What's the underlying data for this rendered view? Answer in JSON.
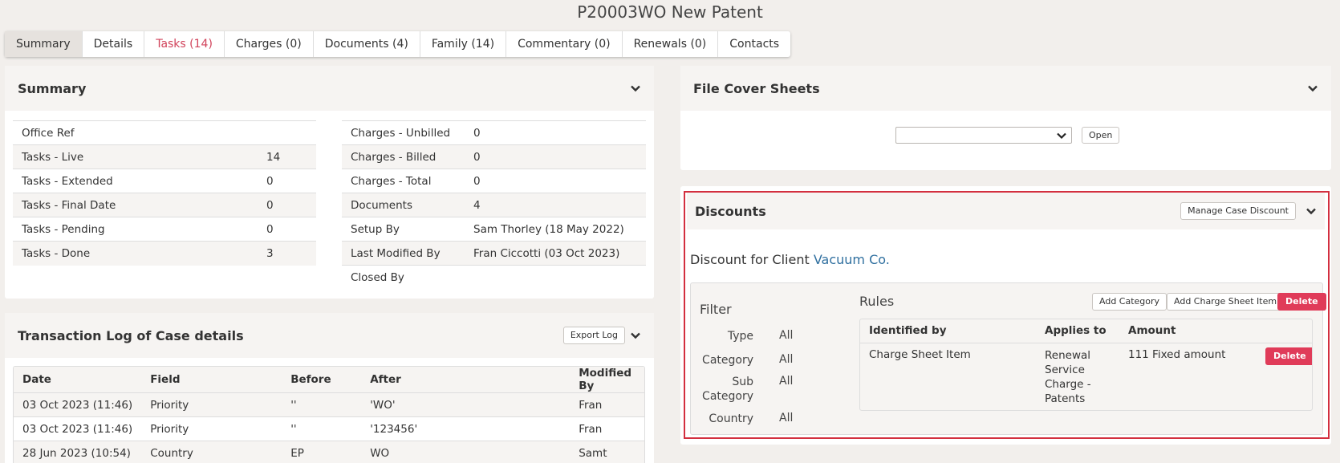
{
  "page": {
    "title": "P20003WO New Patent"
  },
  "tabs": [
    {
      "label": "Summary",
      "active": true
    },
    {
      "label": "Details"
    },
    {
      "label": "Tasks (14)",
      "alert": true
    },
    {
      "label": "Charges (0)"
    },
    {
      "label": "Documents (4)"
    },
    {
      "label": "Family (14)"
    },
    {
      "label": "Commentary (0)"
    },
    {
      "label": "Renewals (0)"
    },
    {
      "label": "Contacts"
    }
  ],
  "summary": {
    "title": "Summary",
    "left": [
      {
        "label": "Office Ref",
        "value": ""
      },
      {
        "label": "Tasks - Live",
        "value": "14"
      },
      {
        "label": "Tasks - Extended",
        "value": "0"
      },
      {
        "label": "Tasks - Final Date",
        "value": "0"
      },
      {
        "label": "Tasks - Pending",
        "value": "0"
      },
      {
        "label": "Tasks - Done",
        "value": "3"
      }
    ],
    "right": [
      {
        "label": "Charges - Unbilled",
        "value": "0"
      },
      {
        "label": "Charges - Billed",
        "value": "0"
      },
      {
        "label": "Charges - Total",
        "value": "0"
      },
      {
        "label": "Documents",
        "value": "4"
      },
      {
        "label": "Setup By",
        "value": "Sam Thorley (18 May 2022)"
      },
      {
        "label": "Last Modified By",
        "value": "Fran Ciccotti (03 Oct 2023)"
      },
      {
        "label": "Closed By",
        "value": ""
      }
    ]
  },
  "transaction_log": {
    "title": "Transaction Log of Case details",
    "export_label": "Export Log",
    "columns": [
      "Date",
      "Field",
      "Before",
      "After",
      "Modified By"
    ],
    "rows": [
      [
        "03 Oct 2023 (11:46)",
        "Priority",
        "''",
        "'WO'",
        "Fran"
      ],
      [
        "03 Oct 2023 (11:46)",
        "Priority",
        "''",
        "'123456'",
        "Fran"
      ],
      [
        "28 Jun 2023 (10:54)",
        "Country",
        "EP",
        "WO",
        "Samt"
      ]
    ]
  },
  "file_cover": {
    "title": "File Cover Sheets",
    "select_value": "",
    "open_label": "Open"
  },
  "discounts": {
    "title": "Discounts",
    "manage_label": "Manage Case Discount",
    "client_prefix": "Discount for Client",
    "client_name": "Vacuum Co.",
    "filter": {
      "title": "Filter",
      "items": [
        {
          "label": "Type",
          "value": "All"
        },
        {
          "label": "Category",
          "value": "All"
        },
        {
          "label": "Sub Category",
          "value": "All"
        },
        {
          "label": "Country",
          "value": "All"
        }
      ]
    },
    "rules": {
      "title": "Rules",
      "add_category_label": "Add Category",
      "add_charge_label": "Add Charge Sheet Item",
      "delete_label": "Delete",
      "columns": [
        "Identified by",
        "Applies to",
        "Amount"
      ],
      "rows": [
        {
          "identified_by": "Charge Sheet Item",
          "applies_to": "Renewal Service Charge - Patents",
          "amount": "111 Fixed amount",
          "delete_label": "Delete"
        }
      ]
    }
  },
  "colors": {
    "accent": "#d1435b",
    "danger": "#e03b59",
    "link": "#2f6f9f",
    "highlight": "#d32f3f"
  }
}
